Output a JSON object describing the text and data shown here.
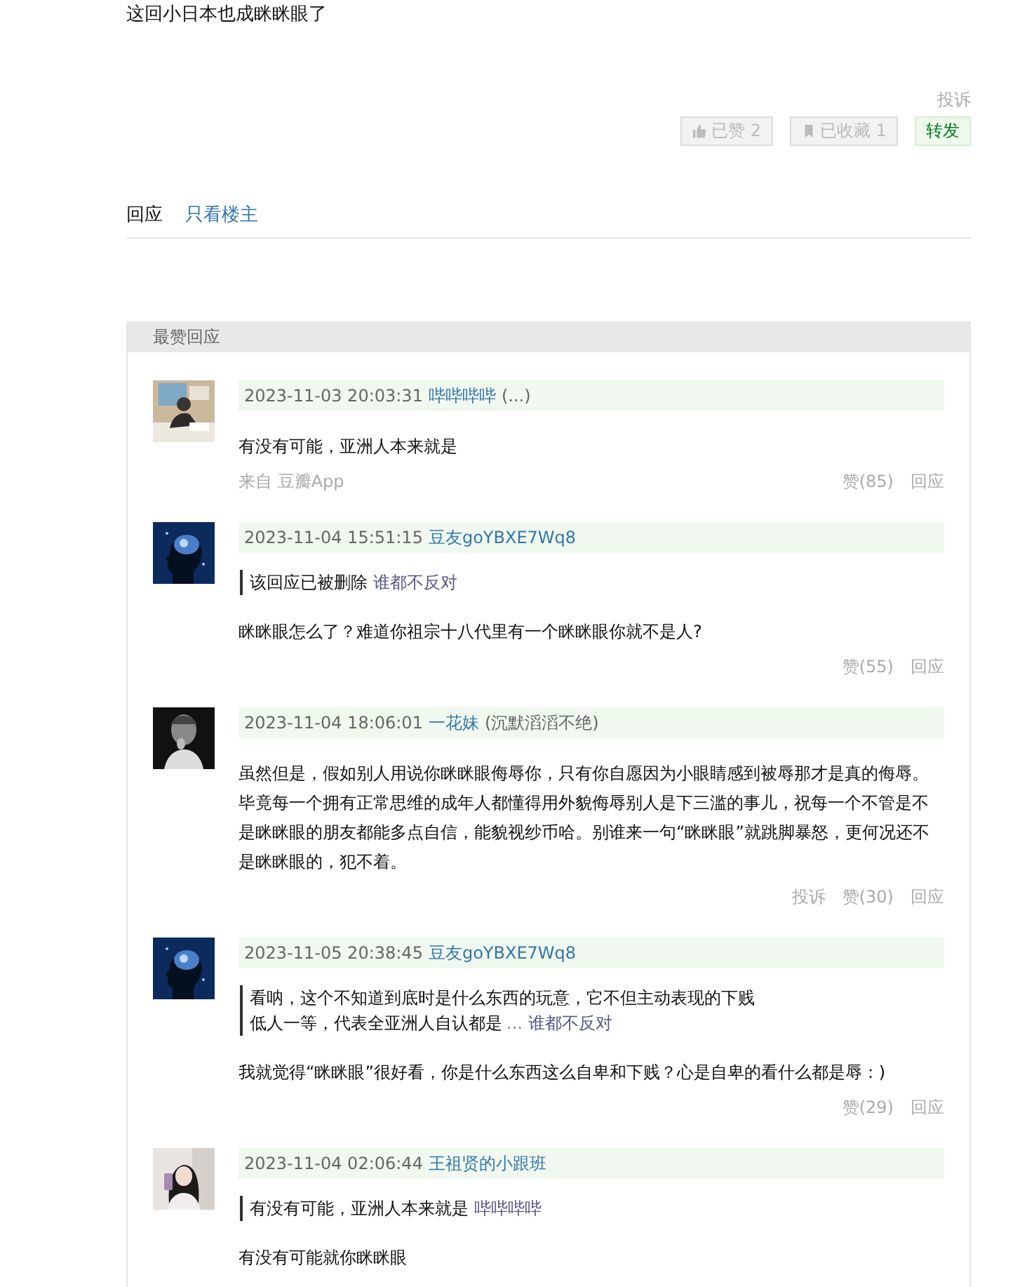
{
  "post": {
    "text": "这回小日本也成眯眯眼了",
    "report": "投诉"
  },
  "actions": [
    {
      "kind": "like",
      "label": "已赞 2",
      "disabled": true
    },
    {
      "kind": "collect",
      "label": "已收藏 1",
      "disabled": true
    },
    {
      "kind": "share",
      "label": "转发",
      "disabled": false
    }
  ],
  "tabs": [
    {
      "label": "回应",
      "selected": true
    },
    {
      "label": "只看楼主",
      "selected": false
    }
  ],
  "top_replies": {
    "title": "最赞回应",
    "comments": [
      {
        "date": "2023-11-03 20:03:31",
        "author": "哔哔哔哔",
        "author_note": "(...)",
        "text": "有没有可能，亚洲人本来就是",
        "source": "来自 豆瓣App",
        "likes": "赞(85)",
        "reply": "回应"
      },
      {
        "date": "2023-11-04 15:51:15",
        "author": "豆友goYBXE7Wq8",
        "quote": {
          "lines": [
            "该回应已被删除"
          ],
          "author": "谁都不反对"
        },
        "text": "眯眯眼怎么了？难道你祖宗十八代里有一个眯眯眼你就不是人?",
        "likes": "赞(55)",
        "reply": "回应"
      },
      {
        "date": "2023-11-04 18:06:01",
        "author": "一花妹",
        "author_note": "(沉默滔滔不绝)",
        "text": "虽然但是，假如别人用说你眯眯眼侮辱你，只有你自愿因为小眼睛感到被辱那才是真的侮辱。毕竟每一个拥有正常思维的成年人都懂得用外貌侮辱别人是下三滥的事儿，祝每一个不管是不是眯眯眼的朋友都能多点自信，能貌视纱币哈。别谁来一句“眯眯眼”就跳脚暴怒，更何况还不是眯眯眼的，犯不着。",
        "report": "投诉",
        "likes": "赞(30)",
        "reply": "回应"
      },
      {
        "date": "2023-11-05 20:38:45",
        "author": "豆友goYBXE7Wq8",
        "quote": {
          "lines": [
            "看呐，这个不知道到底时是什么东西的玩意，它不但主动表现的下贱",
            "低人一等，代表全亚洲人自认都是"
          ],
          "ellipsis": "...",
          "author": "谁都不反对"
        },
        "text": "我就觉得“眯眯眼”很好看，你是什么东西这么自卑和下贱？心是自卑的看什么都是辱：)",
        "likes": "赞(29)",
        "reply": "回应"
      },
      {
        "date": "2023-11-04 02:06:44",
        "author": "王祖贤的小跟班",
        "quote": {
          "lines": [
            "有没有可能，亚洲人本来就是"
          ],
          "author": "哔哔哔哔"
        },
        "text": "有没有可能就你眯眯眼"
      }
    ]
  }
}
